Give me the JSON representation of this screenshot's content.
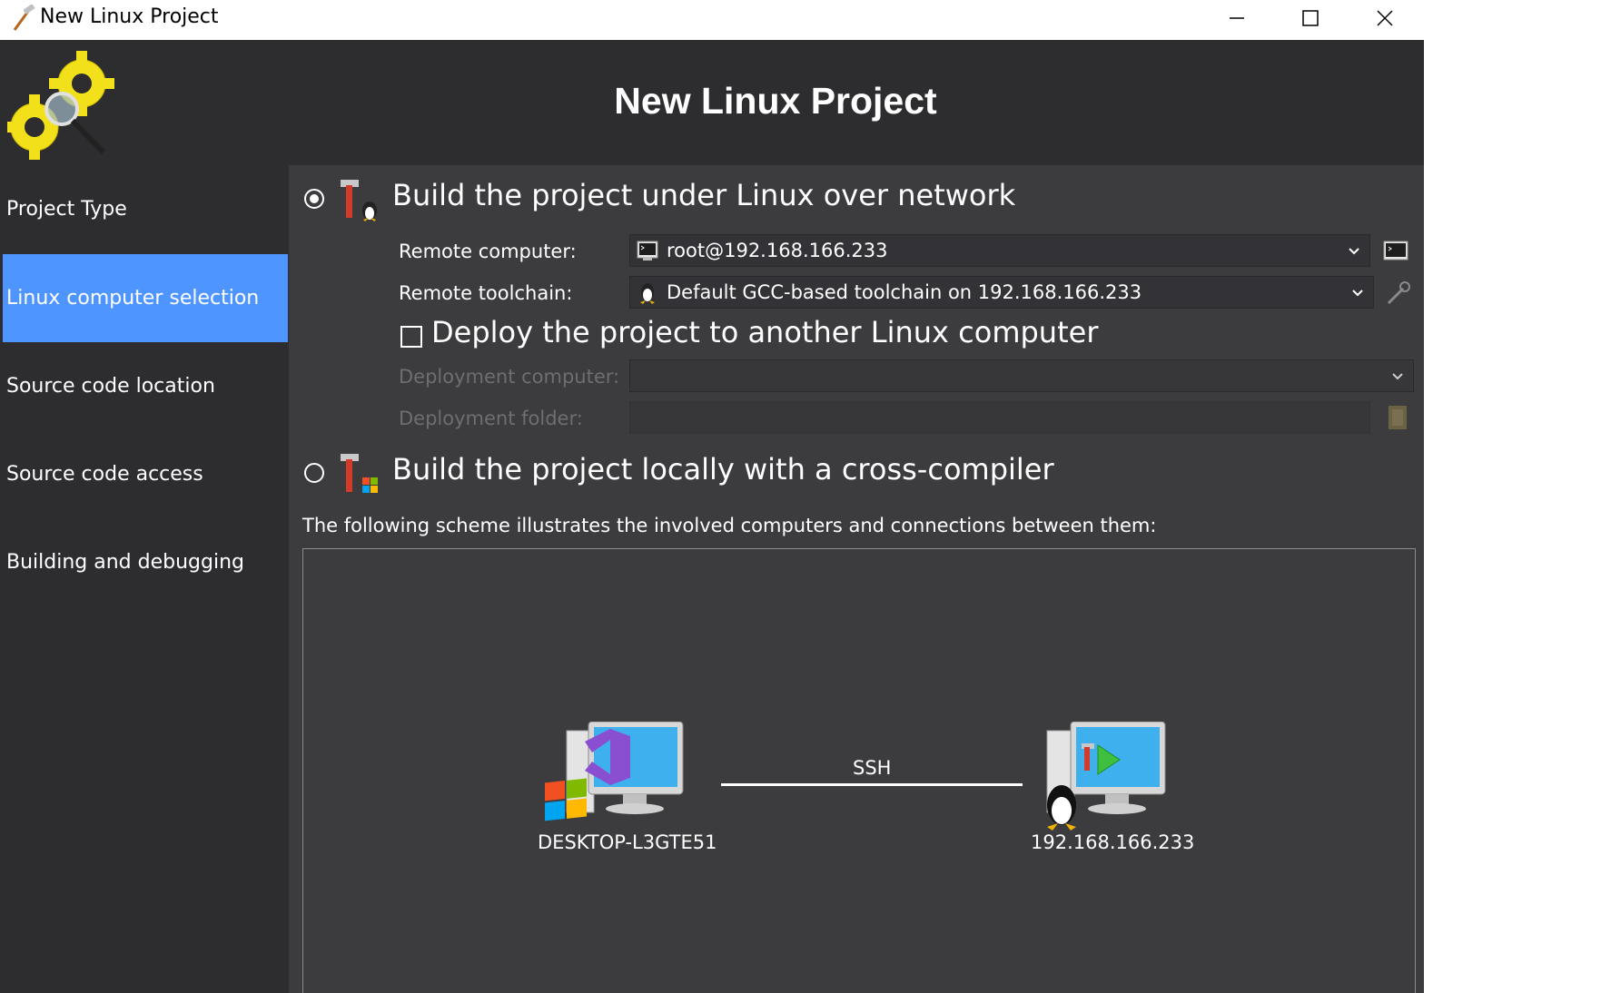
{
  "window": {
    "title": "New Linux Project",
    "controls": [
      "minimize",
      "maximize",
      "close"
    ]
  },
  "header": {
    "title": "New Linux Project"
  },
  "sidebar": {
    "items": [
      {
        "label": "Project Type",
        "active": false
      },
      {
        "label": "Linux computer selection",
        "active": true
      },
      {
        "label": "Source code location",
        "active": false
      },
      {
        "label": "Source code access",
        "active": false
      },
      {
        "label": "Building and debugging",
        "active": false
      }
    ]
  },
  "main": {
    "option_remote": {
      "label": "Build the project under Linux over network",
      "selected": true
    },
    "remote_computer": {
      "label": "Remote computer:",
      "value": "root@192.168.166.233"
    },
    "remote_toolchain": {
      "label": "Remote toolchain:",
      "value": "Default GCC-based toolchain on 192.168.166.233"
    },
    "deploy": {
      "label": "Deploy the project to another Linux computer",
      "checked": false
    },
    "deployment_computer": {
      "label": "Deployment computer:",
      "value": ""
    },
    "deployment_folder": {
      "label": "Deployment folder:",
      "value": ""
    },
    "option_local": {
      "label": "Build the project locally with a cross-compiler",
      "selected": false
    },
    "scheme": {
      "caption": "The following scheme illustrates the involved computers and connections between them:",
      "local_host": "DESKTOP-L3GTE51",
      "connection": "SSH",
      "remote_host": "192.168.166.233"
    }
  },
  "colors": {
    "accent": "#4f95ff",
    "background": "#3c3c3f",
    "header": "#2d2d30"
  }
}
